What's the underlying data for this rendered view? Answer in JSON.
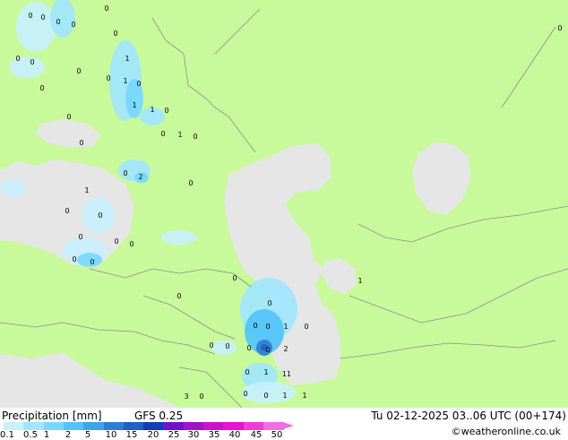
{
  "footer": {
    "product_label": "Precipitation [mm]",
    "model_label": "GFS 0.25",
    "valid_time": "Tu 02-12-2025 03..06 UTC (00+174)",
    "credit": "©weatheronline.co.uk"
  },
  "legend": {
    "ticks": [
      "0.1",
      "0.5",
      "1",
      "2",
      "5",
      "10",
      "15",
      "20",
      "25",
      "30",
      "35",
      "40",
      "45",
      "50"
    ],
    "colors": [
      "#c8f0ff",
      "#a0e6ff",
      "#78d7ff",
      "#50c3fa",
      "#3ca5e6",
      "#2d7dd2",
      "#1e5fc8",
      "#143cb4",
      "#6e14c8",
      "#a014c8",
      "#c814c8",
      "#e614d2",
      "#f03cdc",
      "#f06ee6"
    ]
  },
  "map": {
    "land_color": "#c8fa9b",
    "water_color": "#e6e6e6",
    "precip_values": [
      "0",
      "0",
      "0",
      "0",
      "0",
      "0",
      "0",
      "0",
      "0",
      "0",
      "0",
      "1",
      "1",
      "0",
      "1",
      "1",
      "0",
      "0",
      "1",
      "0",
      "0",
      "0",
      "2",
      "0",
      "0",
      "1",
      "0",
      "0",
      "0",
      "0",
      "0",
      "0",
      "0",
      "0",
      "0",
      "0",
      "0",
      "0",
      "0",
      "0",
      "1",
      "0",
      "3",
      "0",
      "0",
      "0",
      "2",
      "11",
      "0",
      "1",
      "0",
      "0",
      "1",
      "1",
      "1",
      "0"
    ]
  }
}
